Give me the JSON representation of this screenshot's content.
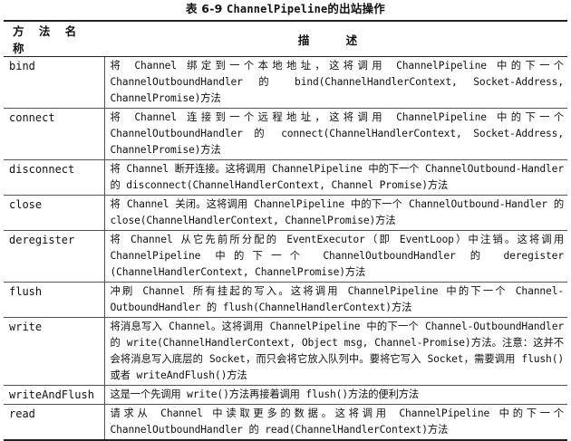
{
  "caption": {
    "prefix": "表 6-9",
    "code": "ChannelPipeline",
    "suffix": "的出站操作"
  },
  "table": {
    "headers": {
      "name": "方 法 名 称",
      "description": "描 述"
    },
    "rows": [
      {
        "name": "bind",
        "description": "将 Channel 绑定到一个本地地址，这将调用 ChannelPipeline 中的下一个 ChannelOutboundHandler 的 bind(ChannelHandlerContext, Socket-Address, ChannelPromise)方法"
      },
      {
        "name": "connect",
        "description": "将 Channel 连接到一个远程地址，这将调用 ChannelPipeline 中的下一个 ChannelOutboundHandler 的 connect(ChannelHandlerContext, Socket-Address, ChannelPromise)方法"
      },
      {
        "name": "disconnect",
        "description": "将 Channel 断开连接。这将调用 ChannelPipeline 中的下一个 ChannelOutbound-Handler 的 disconnect(ChannelHandlerContext, Channel Promise)方法"
      },
      {
        "name": "close",
        "description": "将 Channel 关闭。这将调用 ChannelPipeline 中的下一个 ChannelOutbound-Handler 的 close(ChannelHandlerContext, ChannelPromise)方法"
      },
      {
        "name": "deregister",
        "description": "将 Channel 从它先前所分配的 EventExecutor（即 EventLoop）中注销。这将调用 ChannelPipeline 中的下一个 ChannelOutboundHandler 的 deregister (ChannelHandlerContext, ChannelPromise)方法"
      },
      {
        "name": "flush",
        "description": "冲刷 Channel 所有挂起的写入。这将调用 ChannelPipeline 中的下一个 Channel-OutboundHandler 的 flush(ChannelHandlerContext)方法"
      },
      {
        "name": "write",
        "description": "将消息写入 Channel。这将调用 ChannelPipeline 中的下一个 Channel-OutboundHandler 的 write(ChannelHandlerContext, Object msg, Channel-Promise)方法。注意：这并不会将消息写入底层的 Socket，而只会将它放入队列中。要将它写入 Socket，需要调用 flush()或者 writeAndFlush()方法"
      },
      {
        "name": "writeAndFlush",
        "description": "这是一个先调用 write()方法再接着调用 flush()方法的便利方法"
      },
      {
        "name": "read",
        "description": "请求从 Channel 中读取更多的数据。这将调用 ChannelPipeline 中的下一个 ChannelOutboundHandler 的 read(ChannelHandlerContext)方法"
      }
    ]
  }
}
